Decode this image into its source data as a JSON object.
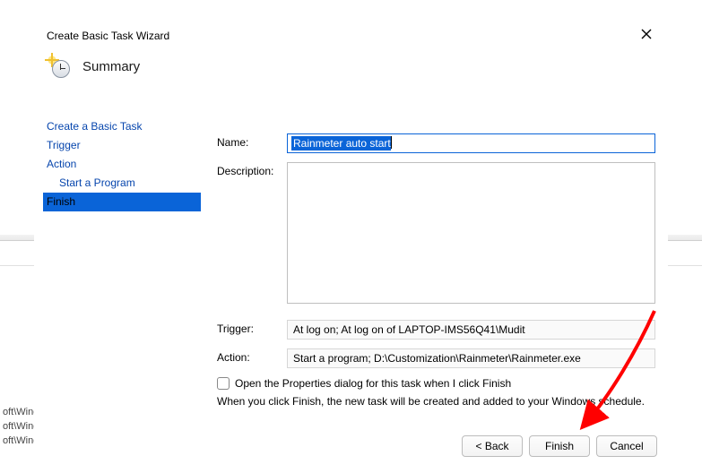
{
  "dialog": {
    "title": "Create Basic Task Wizard",
    "page_title": "Summary"
  },
  "steps": [
    {
      "label": "Create a Basic Task",
      "indent": false,
      "selected": false,
      "link": true
    },
    {
      "label": "Trigger",
      "indent": false,
      "selected": false,
      "link": true
    },
    {
      "label": "Action",
      "indent": false,
      "selected": false,
      "link": true
    },
    {
      "label": "Start a Program",
      "indent": true,
      "selected": false,
      "link": true
    },
    {
      "label": "Finish",
      "indent": false,
      "selected": true,
      "link": false
    }
  ],
  "form": {
    "name_label": "Name:",
    "name_value": "Rainmeter auto start",
    "description_label": "Description:",
    "description_value": "",
    "trigger_label": "Trigger:",
    "trigger_value": "At log on; At log on of LAPTOP-IMS56Q41\\Mudit",
    "action_label": "Action:",
    "action_value": "Start a program; D:\\Customization\\Rainmeter\\Rainmeter.exe",
    "open_properties_label": "Open the Properties dialog for this task when I click Finish",
    "open_properties_checked": false,
    "note": "When you click Finish, the new task will be created and added to your Windows schedule."
  },
  "buttons": {
    "back": "< Back",
    "finish": "Finish",
    "cancel": "Cancel"
  },
  "background_left_items": [
    "oft\\Wind…",
    "oft\\Windows\\U…",
    "oft\\Windows\\ El"
  ]
}
